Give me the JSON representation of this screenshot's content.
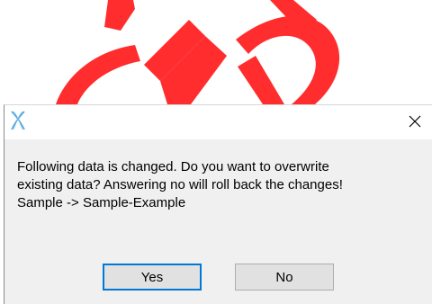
{
  "dialog": {
    "title": "",
    "app_icon": "crossed-x-app-icon",
    "close_icon": "close-icon",
    "message_lines": [
      "Following data is changed. Do you want to overwrite",
      "existing data? Answering no will roll back the changes!",
      "Sample -> Sample-Example"
    ],
    "buttons": {
      "yes_label": "Yes",
      "no_label": "No"
    }
  },
  "colors": {
    "background_art": "#ff2d2d",
    "dialog_bg": "#f0f0f0",
    "default_button_border": "#0078d7",
    "app_icon": "#4aa3df"
  }
}
